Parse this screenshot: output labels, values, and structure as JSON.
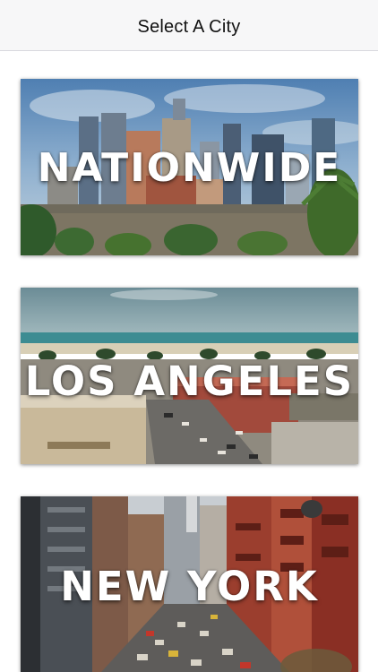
{
  "nav": {
    "title": "Select A City"
  },
  "cities": [
    {
      "label": "NATIONWIDE"
    },
    {
      "label": "LOS ANGELES"
    },
    {
      "label": "NEW YORK"
    }
  ]
}
